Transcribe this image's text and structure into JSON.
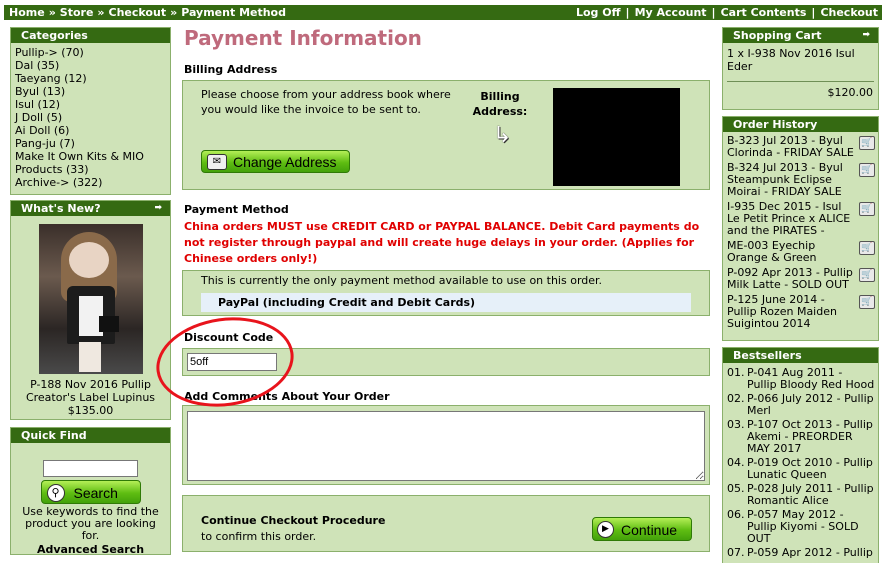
{
  "topbar": {
    "breadcrumb": [
      "Home",
      "Store",
      "Checkout",
      "Payment Method"
    ],
    "separator": "»",
    "links": [
      "Log Off",
      "My Account",
      "Cart Contents",
      "Checkout"
    ]
  },
  "categories": {
    "title": "Categories",
    "items": [
      "Pullip-> (70)",
      "Dal (35)",
      "Taeyang (12)",
      "Byul (13)",
      "Isul (12)",
      "J Doll (5)",
      "Ai Doll (6)",
      "Pang-ju (7)",
      "Make It Own Kits & MIO Products (33)",
      "Archive-> (322)"
    ]
  },
  "whats_new": {
    "title": "What's New?",
    "product_name": "P-188 Nov 2016 Pullip Creator's Label Lupinus",
    "price": "$135.00",
    "arrow": "➡"
  },
  "quick_find": {
    "title": "Quick Find",
    "search_value": "",
    "search_button": "Search",
    "help_text": "Use keywords to find the product you are looking for.",
    "advanced_link": "Advanced Search"
  },
  "page": {
    "title": "Payment Information"
  },
  "billing": {
    "section_title": "Billing Address",
    "instructions": "Please choose from your address book where you would like the invoice to be sent to.",
    "label": "Billing Address:",
    "change_button": "Change Address"
  },
  "payment": {
    "section_title": "Payment Method",
    "warning": "China orders MUST use CREDIT CARD or PAYPAL BALANCE. Debit Card payments do not register through paypal and will create huge delays in your order. (Applies for Chinese orders only!)",
    "note": "This is currently the only payment method available to use on this order.",
    "method": "PayPal (including Credit and Debit Cards)"
  },
  "discount": {
    "section_title": "Discount Code",
    "value": "5off"
  },
  "comments": {
    "section_title": "Add Comments About Your Order",
    "value": ""
  },
  "continue": {
    "title": "Continue Checkout Procedure",
    "subtitle": "to confirm this order.",
    "button": "Continue"
  },
  "cart": {
    "title": "Shopping Cart",
    "item": "1 x I-938 Nov 2016 Isul Eder",
    "total": "$120.00",
    "arrow": "➡"
  },
  "order_history": {
    "title": "Order History",
    "items": [
      "B-323 Jul 2013 - Byul Clorinda - FRIDAY SALE",
      "B-324 Jul 2013 - Byul Steampunk Eclipse Moirai - FRIDAY SALE",
      "I-935 Dec 2015 - Isul Le Petit Prince x ALICE and the PIRATES -",
      "ME-003 Eyechip Orange & Green",
      "P-092 Apr 2013 - Pullip Milk Latte - SOLD OUT",
      "P-125 June 2014 - Pullip Rozen Maiden Suigintou 2014"
    ]
  },
  "bestsellers": {
    "title": "Bestsellers",
    "items": [
      {
        "num": "01.",
        "text": "P-041 Aug 2011 - Pullip Bloody Red Hood"
      },
      {
        "num": "02.",
        "text": "P-066 July 2012 - Pullip Merl"
      },
      {
        "num": "03.",
        "text": "P-107 Oct 2013 - Pullip Akemi - PREORDER MAY 2017"
      },
      {
        "num": "04.",
        "text": "P-019 Oct 2010 - Pullip Lunatic Queen"
      },
      {
        "num": "05.",
        "text": "P-028 July 2011 - Pullip Romantic Alice"
      },
      {
        "num": "06.",
        "text": "P-057 May 2012 - Pullip Kiyomi - SOLD OUT"
      },
      {
        "num": "07.",
        "text": "P-059 Apr 2012 - Pullip"
      }
    ]
  },
  "colors": {
    "nav_green": "#356a12",
    "panel_green": "#cfe3b8",
    "title_pink": "#bf6a7c",
    "warning_red": "#e00000",
    "annotation_red": "#e8141c"
  }
}
